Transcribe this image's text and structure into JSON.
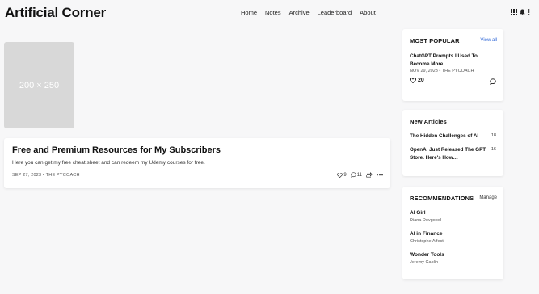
{
  "header": {
    "logo": "Artificial Corner",
    "nav": [
      "Home",
      "Notes",
      "Archive",
      "Leaderboard",
      "About"
    ]
  },
  "placeholder": {
    "label": "200 × 250"
  },
  "post": {
    "title": "Free and Premium Resources for My Subscribers",
    "subtitle": "Here you can get my free cheat sheet and can redeem my Udemy courses for free.",
    "meta": "SEP 27, 2023 • THE PYCOACH",
    "likes": "9",
    "comments": "11"
  },
  "most_popular": {
    "heading": "MOST POPULAR",
    "view_all": "View all",
    "title": "ChatGPT Prompts I Used To Become More…",
    "meta": "NOV 29, 2023  •  THE PYCOACH",
    "likes": "20"
  },
  "new_articles": {
    "heading": "New Articles",
    "items": [
      {
        "title": "The Hidden Challenges of AI",
        "count": "18"
      },
      {
        "title": "OpenAI Just Released The GPT Store. Here's How…",
        "count": "16"
      }
    ]
  },
  "recommendations": {
    "heading": "RECOMMENDATIONS",
    "manage": "Manage",
    "items": [
      {
        "name": "AI Girl",
        "author": "Diana Dovgopol"
      },
      {
        "name": "AI in Finance",
        "author": "Christophe Affect"
      },
      {
        "name": "Wonder Tools",
        "author": "Jeremy Caplin"
      }
    ]
  },
  "colors": {
    "accent_link": "#2a63d6",
    "background": "#f7f7f8",
    "card": "#ffffff",
    "placeholder": "#d8d8d8"
  },
  "icons": [
    "grid-icon",
    "bell-icon",
    "more-vertical-icon",
    "heart-icon",
    "comment-icon",
    "restack-icon",
    "more-horizontal-icon"
  ]
}
